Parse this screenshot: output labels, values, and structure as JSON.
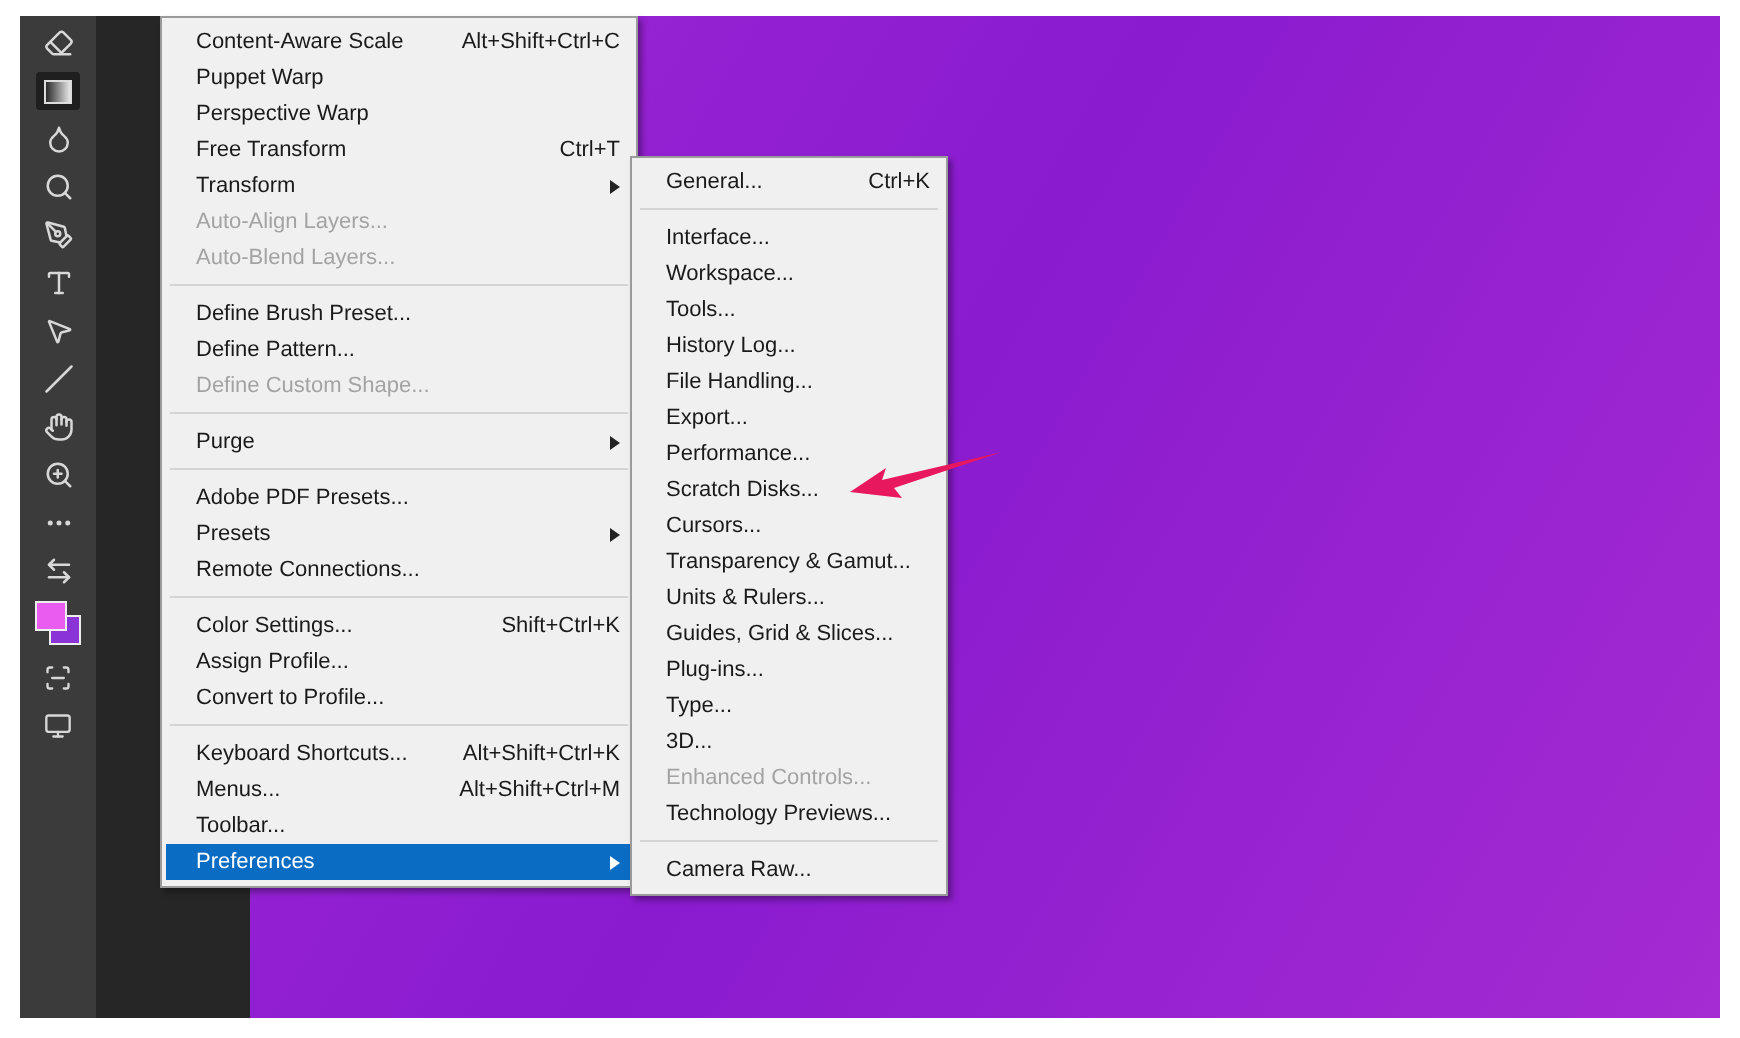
{
  "menu": {
    "groups": [
      {
        "items": [
          {
            "label": "Content-Aware Scale",
            "shortcut": "Alt+Shift+Ctrl+C",
            "disabled": false,
            "submenu": false,
            "selected": false
          },
          {
            "label": "Puppet Warp",
            "disabled": false,
            "submenu": false,
            "selected": false
          },
          {
            "label": "Perspective Warp",
            "disabled": false,
            "submenu": false,
            "selected": false
          },
          {
            "label": "Free Transform",
            "shortcut": "Ctrl+T",
            "disabled": false,
            "submenu": false,
            "selected": false
          },
          {
            "label": "Transform",
            "disabled": false,
            "submenu": true,
            "selected": false
          },
          {
            "label": "Auto-Align Layers...",
            "disabled": true,
            "submenu": false,
            "selected": false
          },
          {
            "label": "Auto-Blend Layers...",
            "disabled": true,
            "submenu": false,
            "selected": false
          }
        ]
      },
      {
        "items": [
          {
            "label": "Define Brush Preset...",
            "disabled": false,
            "submenu": false,
            "selected": false
          },
          {
            "label": "Define Pattern...",
            "disabled": false,
            "submenu": false,
            "selected": false
          },
          {
            "label": "Define Custom Shape...",
            "disabled": true,
            "submenu": false,
            "selected": false
          }
        ]
      },
      {
        "items": [
          {
            "label": "Purge",
            "disabled": false,
            "submenu": true,
            "selected": false
          }
        ]
      },
      {
        "items": [
          {
            "label": "Adobe PDF Presets...",
            "disabled": false,
            "submenu": false,
            "selected": false
          },
          {
            "label": "Presets",
            "disabled": false,
            "submenu": true,
            "selected": false
          },
          {
            "label": "Remote Connections...",
            "disabled": false,
            "submenu": false,
            "selected": false
          }
        ]
      },
      {
        "items": [
          {
            "label": "Color Settings...",
            "shortcut": "Shift+Ctrl+K",
            "disabled": false,
            "submenu": false,
            "selected": false
          },
          {
            "label": "Assign Profile...",
            "disabled": false,
            "submenu": false,
            "selected": false
          },
          {
            "label": "Convert to Profile...",
            "disabled": false,
            "submenu": false,
            "selected": false
          }
        ]
      },
      {
        "items": [
          {
            "label": "Keyboard Shortcuts...",
            "shortcut": "Alt+Shift+Ctrl+K",
            "disabled": false,
            "submenu": false,
            "selected": false
          },
          {
            "label": "Menus...",
            "shortcut": "Alt+Shift+Ctrl+M",
            "disabled": false,
            "submenu": false,
            "selected": false
          },
          {
            "label": "Toolbar...",
            "disabled": false,
            "submenu": false,
            "selected": false
          },
          {
            "label": "Preferences",
            "disabled": false,
            "submenu": true,
            "selected": true
          }
        ]
      }
    ]
  },
  "submenu": {
    "groups": [
      {
        "items": [
          {
            "label": "General...",
            "shortcut": "Ctrl+K",
            "disabled": false
          }
        ]
      },
      {
        "items": [
          {
            "label": "Interface...",
            "disabled": false
          },
          {
            "label": "Workspace...",
            "disabled": false
          },
          {
            "label": "Tools...",
            "disabled": false
          },
          {
            "label": "History Log...",
            "disabled": false
          },
          {
            "label": "File Handling...",
            "disabled": false
          },
          {
            "label": "Export...",
            "disabled": false
          },
          {
            "label": "Performance...",
            "disabled": false
          },
          {
            "label": "Scratch Disks...",
            "disabled": false
          },
          {
            "label": "Cursors...",
            "disabled": false
          },
          {
            "label": "Transparency & Gamut...",
            "disabled": false
          },
          {
            "label": "Units & Rulers...",
            "disabled": false
          },
          {
            "label": "Guides, Grid & Slices...",
            "disabled": false
          },
          {
            "label": "Plug-ins...",
            "disabled": false
          },
          {
            "label": "Type...",
            "disabled": false
          },
          {
            "label": "3D...",
            "disabled": false
          },
          {
            "label": "Enhanced Controls...",
            "disabled": true
          },
          {
            "label": "Technology Previews...",
            "disabled": false
          }
        ]
      },
      {
        "items": [
          {
            "label": "Camera Raw...",
            "disabled": false
          }
        ]
      }
    ]
  }
}
